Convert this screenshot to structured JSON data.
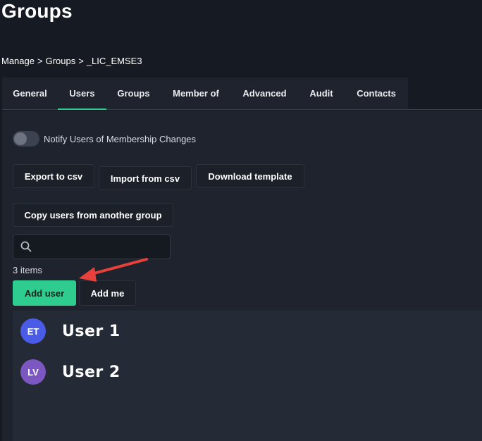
{
  "page": {
    "title": "Groups"
  },
  "breadcrumb": {
    "items": [
      "Manage",
      ">",
      "Groups",
      ">",
      "_LIC_EMSE3"
    ]
  },
  "tabs": [
    {
      "label": "General"
    },
    {
      "label": "Users",
      "active": true
    },
    {
      "label": "Groups"
    },
    {
      "label": "Member of"
    },
    {
      "label": "Advanced"
    },
    {
      "label": "Audit"
    },
    {
      "label": "Contacts"
    }
  ],
  "toggle": {
    "label": "Notify Users of Membership Changes",
    "on": false
  },
  "actions": {
    "export_label": "Export to csv",
    "import_label": "Import from csv",
    "download_label": "Download template",
    "copy_label": "Copy users from another group"
  },
  "search": {
    "placeholder": "",
    "icon": "search-icon"
  },
  "items_count": "3 items",
  "buttons": {
    "add_user": "Add user",
    "add_me": "Add me"
  },
  "users": [
    {
      "initials": "ET",
      "name": "User 1",
      "avatar_color": "#4a5be8"
    },
    {
      "initials": "LV",
      "name": "User 2",
      "avatar_color": "#7d57c1"
    }
  ],
  "colors": {
    "accent": "#2ecc8f",
    "annotation_arrow": "#e8403a"
  }
}
